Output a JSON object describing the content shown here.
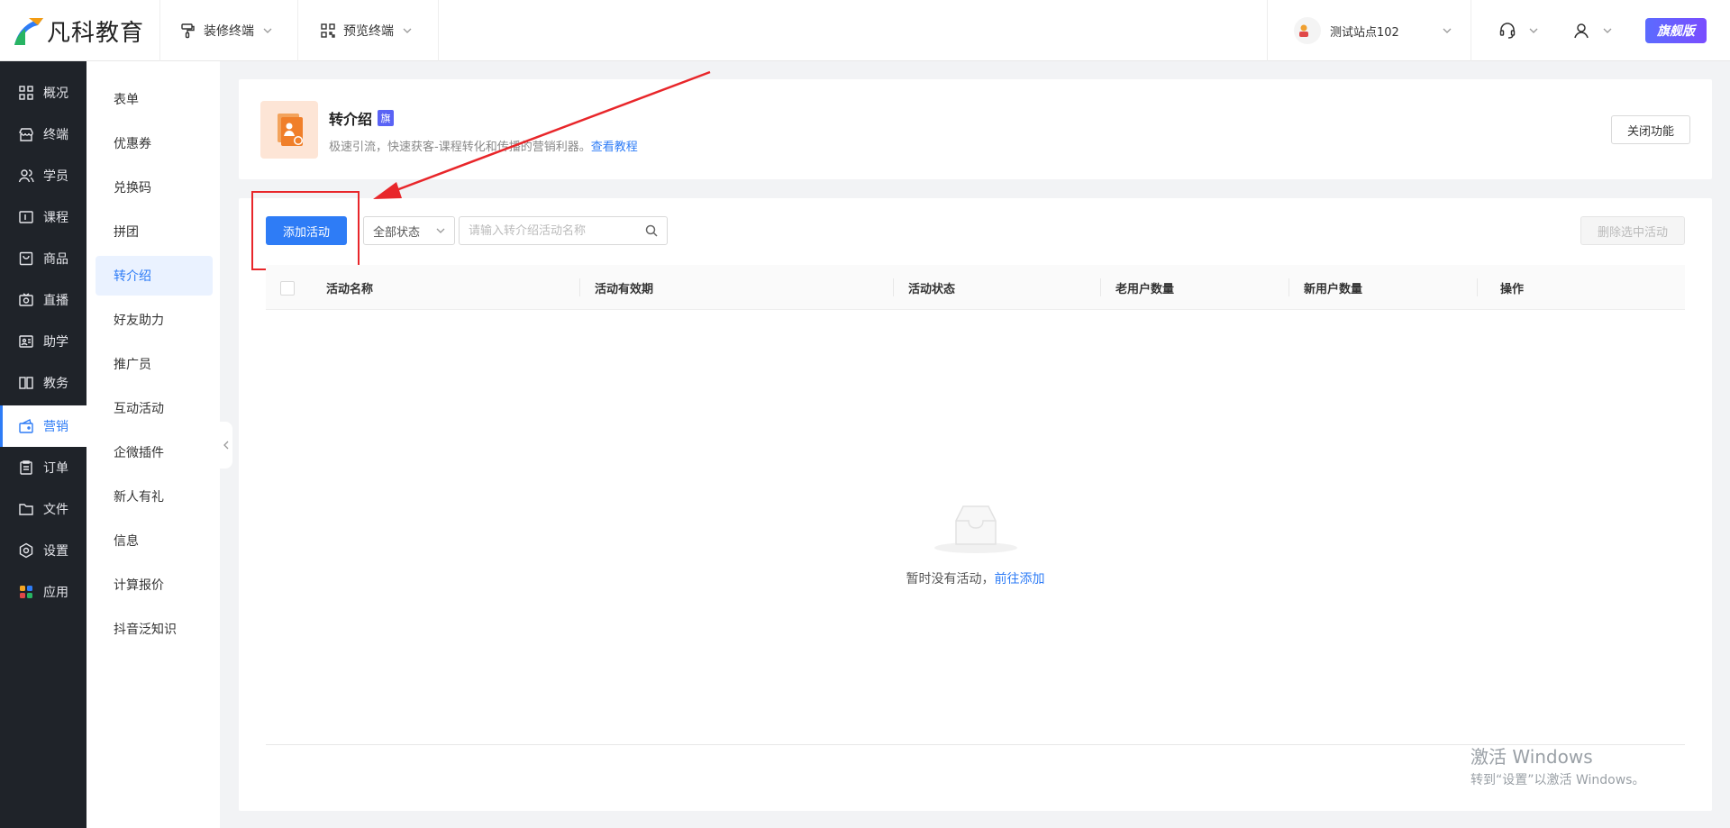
{
  "brand": {
    "name": "凡科教育"
  },
  "topbar": {
    "decorate": "装修终端",
    "preview": "预览终端",
    "site": "测试站点102",
    "edition": "旗舰版"
  },
  "nav": [
    {
      "label": "概况",
      "icon": "dashboard-icon"
    },
    {
      "label": "终端",
      "icon": "store-icon"
    },
    {
      "label": "学员",
      "icon": "students-icon"
    },
    {
      "label": "课程",
      "icon": "course-icon"
    },
    {
      "label": "商品",
      "icon": "goods-icon"
    },
    {
      "label": "直播",
      "icon": "live-icon"
    },
    {
      "label": "助学",
      "icon": "assist-icon"
    },
    {
      "label": "教务",
      "icon": "academic-icon"
    },
    {
      "label": "营销",
      "icon": "marketing-icon"
    },
    {
      "label": "订单",
      "icon": "order-icon"
    },
    {
      "label": "文件",
      "icon": "folder-icon"
    },
    {
      "label": "设置",
      "icon": "settings-icon"
    },
    {
      "label": "应用",
      "icon": "apps-icon"
    }
  ],
  "submenu": [
    "表单",
    "优惠券",
    "兑换码",
    "拼团",
    "转介绍",
    "好友助力",
    "推广员",
    "互动活动",
    "企微插件",
    "新人有礼",
    "信息",
    "计算报价",
    "抖音泛知识"
  ],
  "feature": {
    "title": "转介绍",
    "flag": "旗",
    "desc": "极速引流，快速获客-课程转化和传播的营销利器。",
    "tutorial": "查看教程",
    "close": "关闭功能"
  },
  "toolbar": {
    "add": "添加活动",
    "status": "全部状态",
    "search_placeholder": "请输入转介绍活动名称",
    "delete": "删除选中活动"
  },
  "table": {
    "columns": [
      "活动名称",
      "活动有效期",
      "活动状态",
      "老用户数量",
      "新用户数量",
      "操作"
    ]
  },
  "empty": {
    "text": "暂时没有活动，",
    "link": "前往添加"
  },
  "watermark": {
    "line1": "激活 Windows",
    "line2": "转到“设置”以激活 Windows。"
  }
}
